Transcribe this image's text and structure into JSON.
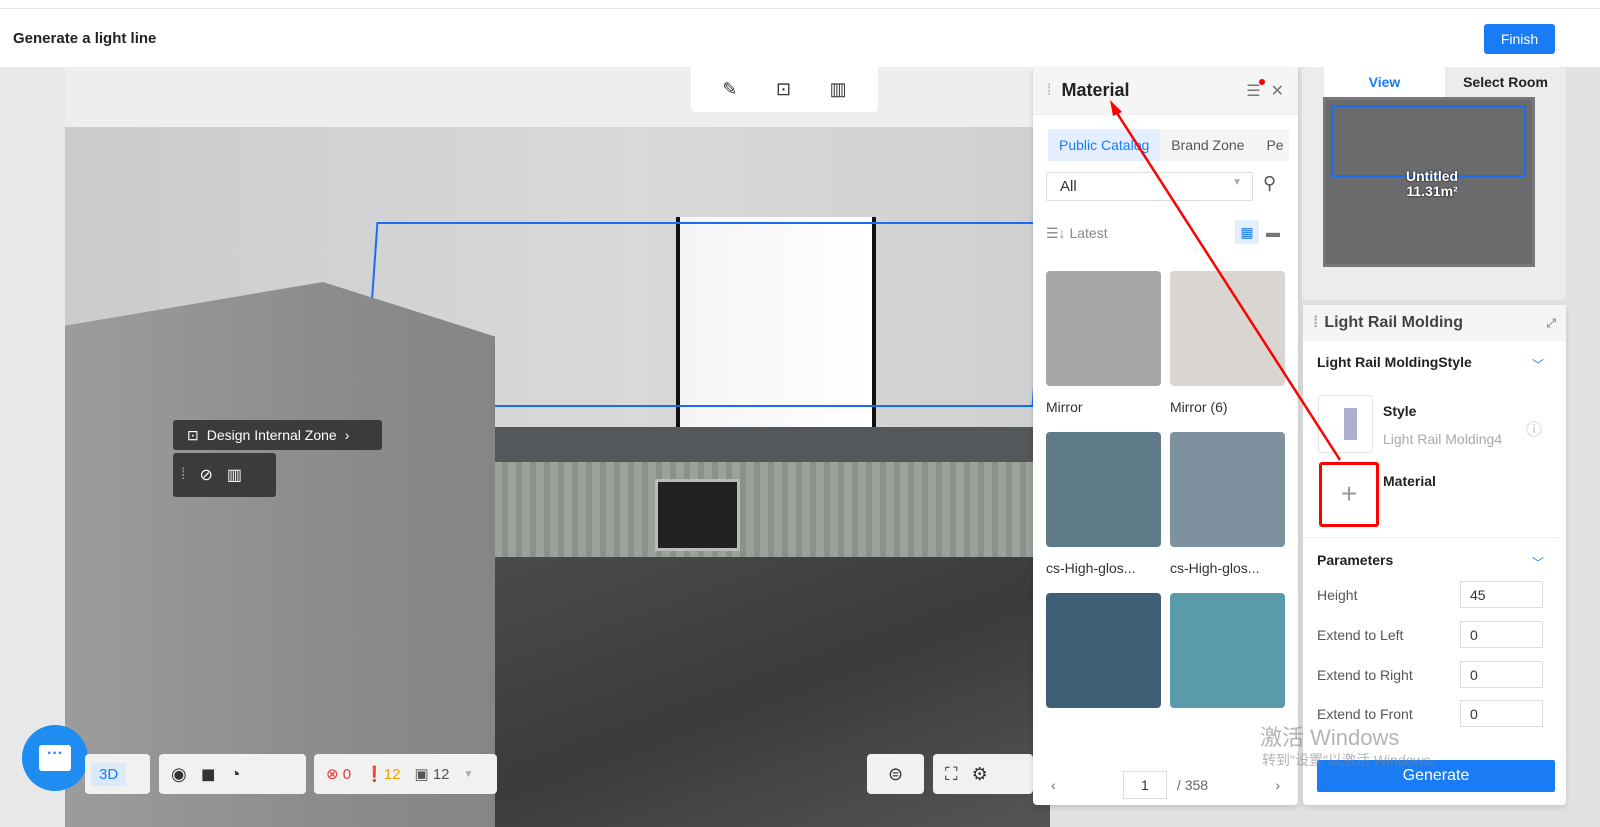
{
  "header": {
    "title": "Generate a light line",
    "finish_label": "Finish"
  },
  "viewport": {
    "zone_tooltip": "Design Internal Zone",
    "bottom": {
      "view_mode": "3D",
      "errors": "0",
      "warnings": "12",
      "items": "12"
    }
  },
  "material_panel": {
    "title": "Material",
    "tabs": [
      {
        "label": "Public Catalog",
        "active": true
      },
      {
        "label": "Brand Zone"
      },
      {
        "label": "Pe"
      }
    ],
    "filter": "All",
    "sort": "Latest",
    "items": [
      {
        "name": "Mirror",
        "color": "#a7a6a8"
      },
      {
        "name": "Mirror (6)",
        "color": "#d9d6d2"
      },
      {
        "name": "cs-High-glos...",
        "color": "#5f7b88"
      },
      {
        "name": "cs-High-glos...",
        "color": "#7d929e"
      },
      {
        "name": "",
        "color": "#3f5f74"
      },
      {
        "name": "",
        "color": "#5b9aa8"
      }
    ],
    "page": "1",
    "total_pages": "/ 358"
  },
  "minimap": {
    "tabs": [
      "View",
      "Select Room"
    ],
    "room_name": "Untitled",
    "room_area": "11.31m²"
  },
  "properties": {
    "title": "Light Rail Molding",
    "style_section": "Light Rail MoldingStyle",
    "style_label": "Style",
    "style_value": "Light Rail Molding4",
    "material_label": "Material",
    "params_section": "Parameters",
    "params": [
      {
        "label": "Height",
        "value": "45"
      },
      {
        "label": "Extend to Left",
        "value": "0"
      },
      {
        "label": "Extend to Right",
        "value": "0"
      },
      {
        "label": "Extend to Front",
        "value": "0"
      }
    ],
    "generate_label": "Generate"
  },
  "watermark": {
    "line1": "激活 Windows",
    "line2": "转到\"设置\"以激活 Windows。"
  },
  "colors": {
    "accent": "#1a7cf5",
    "highlight": "#ff0000"
  }
}
